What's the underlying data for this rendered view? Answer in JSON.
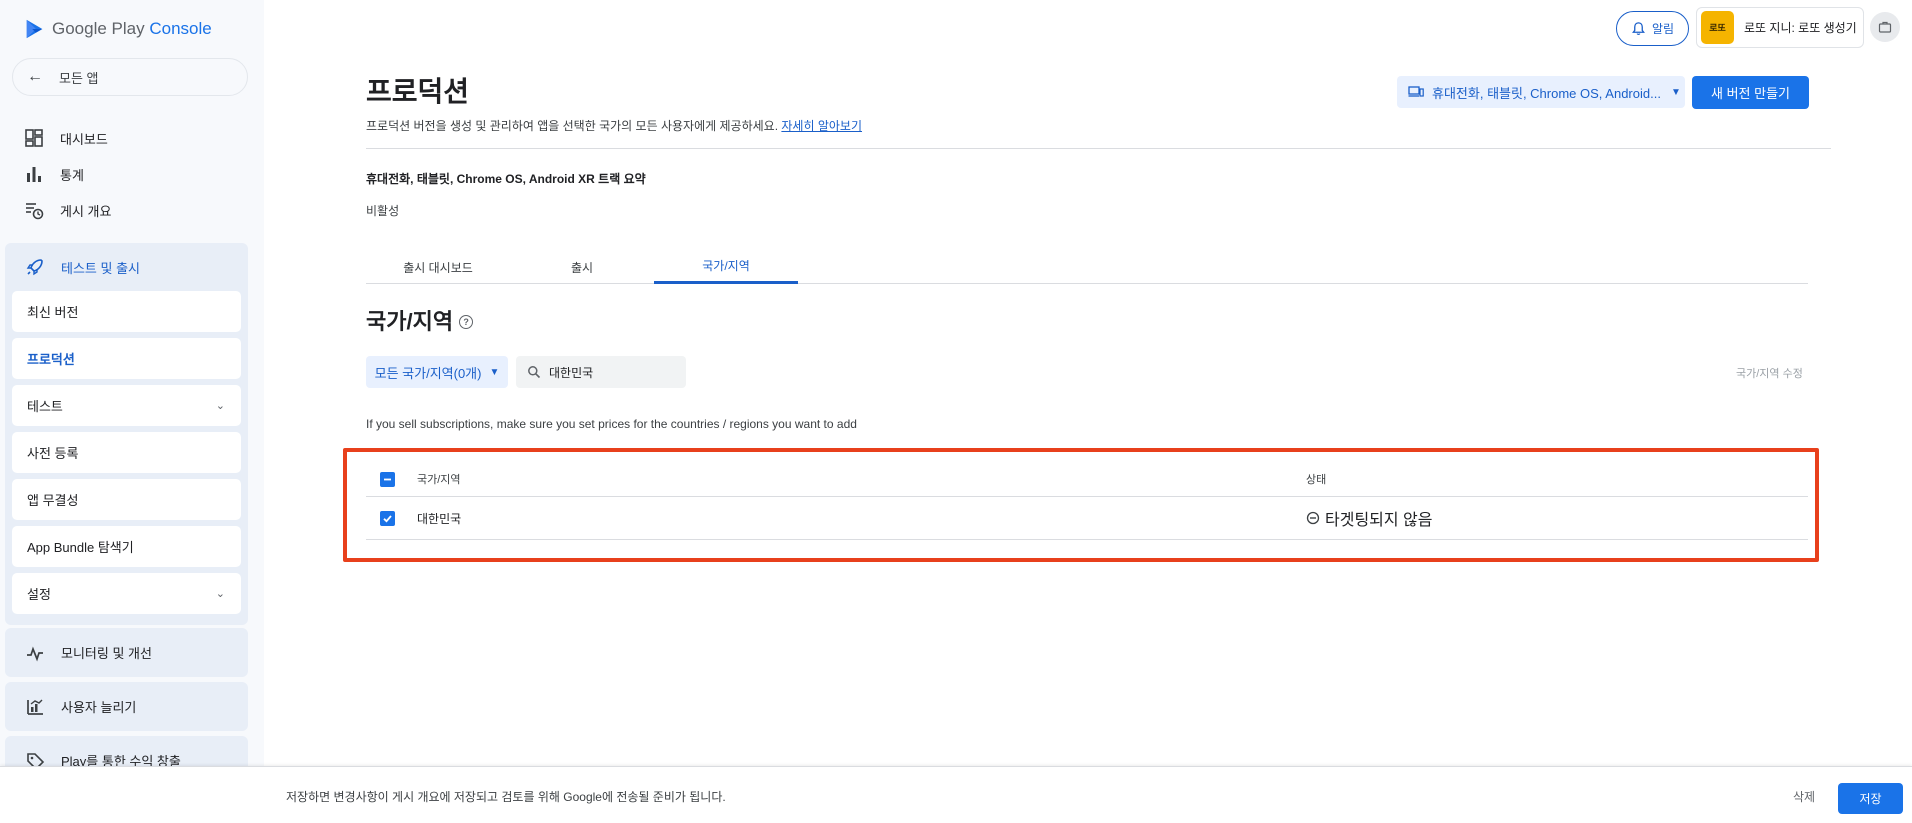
{
  "brand": {
    "google_play": "Google Play",
    "console": "Console"
  },
  "sidebar": {
    "back_label": "모든 앱",
    "items": [
      {
        "label": "대시보드",
        "icon": "dashboard-icon"
      },
      {
        "label": "통계",
        "icon": "bar-chart-icon"
      },
      {
        "label": "게시 개요",
        "icon": "publishing-overview-icon"
      }
    ],
    "test_release": {
      "label": "테스트 및 출시",
      "icon": "rocket-icon",
      "children": [
        {
          "label": "최신 버전"
        },
        {
          "label": "프로덕션",
          "active": true
        },
        {
          "label": "테스트",
          "expandable": true
        },
        {
          "label": "사전 등록"
        },
        {
          "label": "앱 무결성"
        },
        {
          "label": "App Bundle 탐색기"
        },
        {
          "label": "설정",
          "expandable": true
        }
      ]
    },
    "monitoring": {
      "label": "모니터링 및 개선",
      "icon": "monitoring-icon"
    },
    "grow_users": {
      "label": "사용자 늘리기",
      "icon": "grow-users-icon"
    },
    "monetize": {
      "label": "Play를 통한 수익 창출",
      "icon": "tag-icon"
    }
  },
  "header": {
    "notifications_label": "알림",
    "app_name": "로또 지니: 로또 생성기",
    "app_icon_text": "로또"
  },
  "page": {
    "title": "프로덕션",
    "description": "프로덕션 버전을 생성 및 관리하여 앱을 선택한 국가의 모든 사용자에게 제공하세요.",
    "learn_more": "자세히 알아보기",
    "track_selector": "휴대전화, 태블릿, Chrome OS, Android...",
    "new_release_button": "새 버전 만들기",
    "summary_title": "휴대전화, 태블릿, Chrome OS, Android XR 트랙 요약",
    "summary_status": "비활성",
    "tabs": [
      {
        "label": "출시 대시보드"
      },
      {
        "label": "출시"
      },
      {
        "label": "국가/지역",
        "active": true
      }
    ]
  },
  "countries": {
    "title": "국가/지역",
    "filter_label": "모든 국가/지역(0개)",
    "search_value": "대한민국",
    "edit_label": "국가/지역 수정",
    "note": "If you sell subscriptions, make sure you set prices for the countries / regions you want to add",
    "table": {
      "headers": {
        "country": "국가/지역",
        "status": "상태"
      },
      "rows": [
        {
          "country": "대한민국",
          "status": "타겟팅되지 않음",
          "checked": true
        }
      ]
    }
  },
  "bottom_bar": {
    "message": "저장하면 변경사항이 게시 개요에 저장되고 검토를 위해 Google에 전송될 준비가 됩니다.",
    "discard_label": "삭제",
    "save_label": "저장"
  },
  "colors": {
    "accent": "#1a73e8",
    "highlight": "#e8401c",
    "sidebar_active_bg": "#e8eef7"
  }
}
